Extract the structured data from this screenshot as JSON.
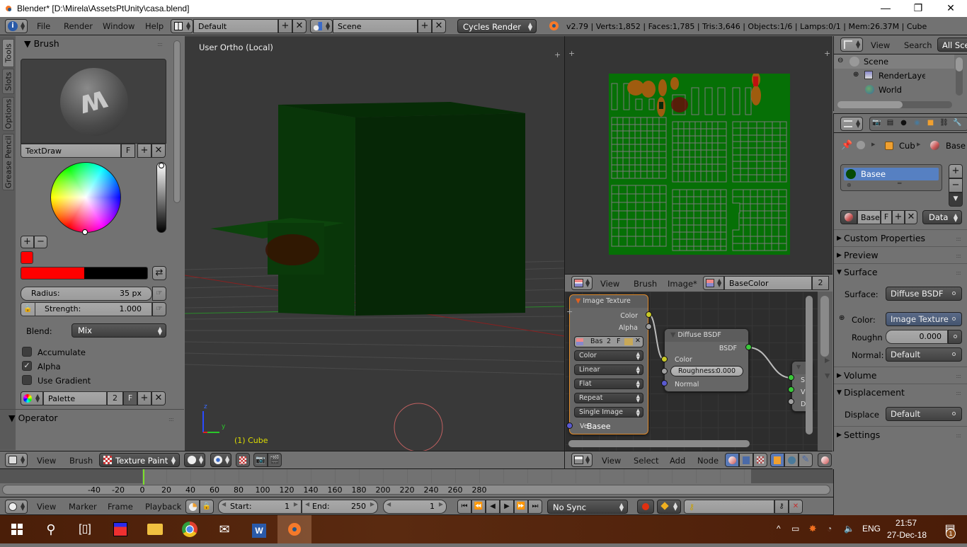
{
  "window": {
    "title": "Blender* [D:\\Mirela\\AssetsPtUnity\\casa.blend]",
    "controls": [
      "minimize",
      "restore",
      "close"
    ]
  },
  "info_header": {
    "editor_icon": "info-icon",
    "menus": [
      "File",
      "Render",
      "Window",
      "Help"
    ],
    "screen_layout": "Default",
    "scene": "Scene",
    "render_engine": "Cycles Render",
    "stats": "v2.79 | Verts:1,852 | Faces:1,785 | Tris:3,646 | Objects:1/6 | Lamps:0/1 | Mem:26.37M | Cube"
  },
  "tool_shelf": {
    "tabs": [
      "Tools",
      "Slots",
      "Options",
      "Grease Pencil"
    ],
    "active_tab": "Tools",
    "brush_panel": {
      "title": "Brush",
      "brush_name": "TextDraw",
      "fake_user": "F",
      "color_hex": "#ff0000",
      "gradient_secondary": "#000000",
      "radius_label": "Radius:",
      "radius_value": "35 px",
      "strength_label": "Strength:",
      "strength_value": "1.000",
      "blend_label": "Blend:",
      "blend_value": "Mix",
      "checkboxes": [
        {
          "label": "Accumulate",
          "checked": false
        },
        {
          "label": "Alpha",
          "checked": true
        },
        {
          "label": "Use Gradient",
          "checked": false
        }
      ],
      "palette_name": "Palette",
      "palette_users": "2",
      "palette_fake": "F"
    },
    "operator_panel": {
      "title": "Operator"
    }
  },
  "viewport": {
    "view_label": "User Ortho (Local)",
    "object_label": "(1) Cube",
    "axes": {
      "x": "x",
      "y": "y",
      "z": "z"
    },
    "header": {
      "menus": [
        "View",
        "Brush"
      ],
      "mode": "Texture Paint"
    }
  },
  "image_editor": {
    "header": {
      "menus": [
        "View",
        "Brush",
        "Image*"
      ],
      "image_name": "BaseColor",
      "users": "2"
    }
  },
  "node_editor": {
    "nodes": {
      "image_texture": {
        "title": "Image Texture",
        "outputs": [
          "Color",
          "Alpha"
        ],
        "image_name": "Bas",
        "users": "2",
        "fake": "F",
        "color_space": "Color",
        "interpolation": "Linear",
        "projection": "Flat",
        "extension": "Repeat",
        "source": "Single Image",
        "vector_input": "Ve",
        "overlay_text": "Basee"
      },
      "diffuse_bsdf": {
        "title": "Diffuse BSDF",
        "output": "BSDF",
        "inputs": [
          "Color",
          "Roughness:",
          "Normal"
        ],
        "roughness": "0.000"
      },
      "material_output": {
        "inputs": [
          "S",
          "V",
          "D"
        ]
      }
    },
    "header": {
      "menus": [
        "View",
        "Select",
        "Add",
        "Node"
      ]
    }
  },
  "outliner": {
    "header": {
      "menus": [
        "View",
        "Search"
      ],
      "filter": "All Scenes"
    },
    "items": [
      {
        "label": "Scene",
        "icon": "scene-icon",
        "expanded": true
      },
      {
        "label": "RenderLayers",
        "icon": "render-layers-icon"
      },
      {
        "label": "World",
        "icon": "world-icon"
      }
    ]
  },
  "properties": {
    "breadcrumb": [
      "Cub",
      "Base"
    ],
    "material_slots": [
      {
        "name": "Basee",
        "selected": true
      }
    ],
    "material_name": "Base",
    "material_fake": "F",
    "link_mode": "Data",
    "sections": [
      {
        "title": "Custom Properties",
        "expanded": false
      },
      {
        "title": "Preview",
        "expanded": false
      },
      {
        "title": "Surface",
        "expanded": true
      },
      {
        "title": "Volume",
        "expanded": false
      },
      {
        "title": "Displacement",
        "expanded": true
      },
      {
        "title": "Settings",
        "expanded": false
      }
    ],
    "surface": {
      "surface_label": "Surface:",
      "surface_value": "Diffuse BSDF",
      "color_label": "Color:",
      "color_value": "Image Texture",
      "roughness_label": "Roughn",
      "roughness_value": "0.000",
      "normal_label": "Normal:",
      "normal_value": "Default"
    },
    "displacement": {
      "label": "Displace",
      "value": "Default"
    }
  },
  "timeline": {
    "ticks": [
      "-40",
      "-20",
      "0",
      "20",
      "40",
      "60",
      "80",
      "100",
      "120",
      "140",
      "160",
      "180",
      "200",
      "220",
      "240",
      "260",
      "280"
    ],
    "current_frame_marker": 1,
    "header": {
      "menus": [
        "View",
        "Marker",
        "Frame",
        "Playback"
      ],
      "start_label": "Start:",
      "start_value": "1",
      "end_label": "End:",
      "end_value": "250",
      "current_frame": "1",
      "sync": "No Sync"
    }
  },
  "taskbar": {
    "apps": [
      "start",
      "search",
      "task-view",
      "floppy-app",
      "file-explorer",
      "chrome",
      "mail",
      "word",
      "blender"
    ],
    "tray": {
      "language": "ENG",
      "time": "21:57",
      "date": "27-Dec-18",
      "notifications": "1"
    }
  }
}
